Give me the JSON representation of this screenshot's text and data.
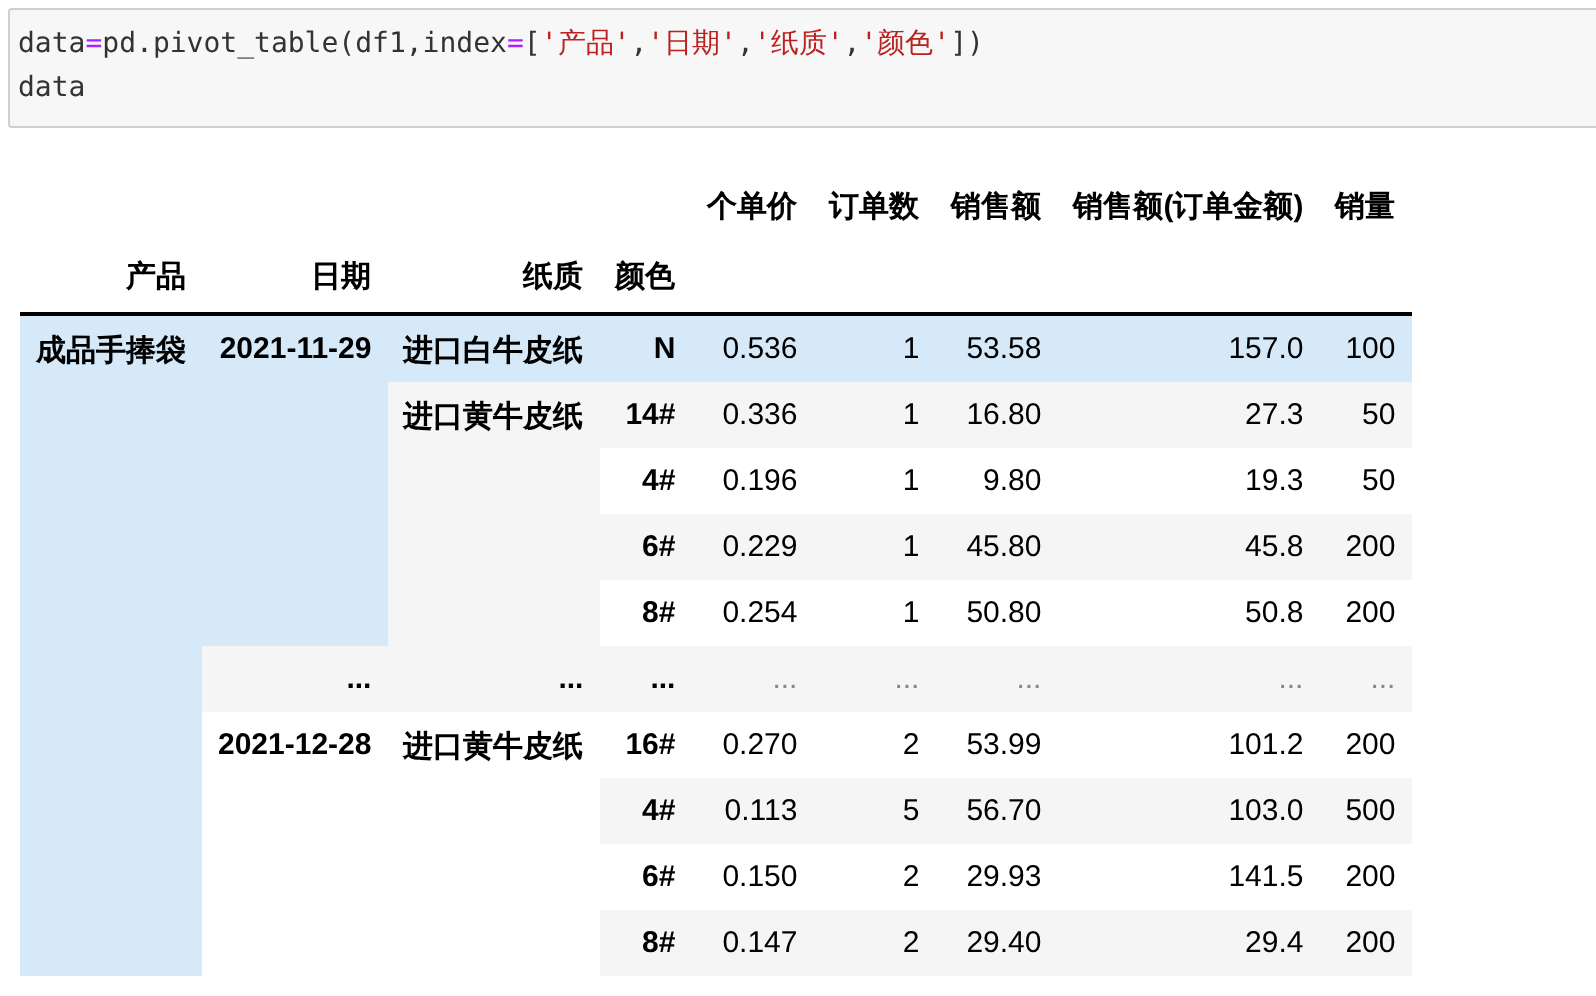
{
  "code_cell": {
    "lines": [
      [
        {
          "kind": "plain",
          "text": "data"
        },
        {
          "kind": "operator",
          "text": "="
        },
        {
          "kind": "plain",
          "text": "pd.pivot_table(df1,index"
        },
        {
          "kind": "operator",
          "text": "="
        },
        {
          "kind": "plain",
          "text": "["
        },
        {
          "kind": "string",
          "text": "'产品'"
        },
        {
          "kind": "plain",
          "text": ","
        },
        {
          "kind": "string",
          "text": "'日期'"
        },
        {
          "kind": "plain",
          "text": ","
        },
        {
          "kind": "string",
          "text": "'纸质'"
        },
        {
          "kind": "plain",
          "text": ","
        },
        {
          "kind": "string",
          "text": "'颜色'"
        },
        {
          "kind": "plain",
          "text": "])"
        }
      ],
      [
        {
          "kind": "plain",
          "text": "data"
        }
      ]
    ]
  },
  "table": {
    "columns": [
      "个单价",
      "订单数",
      "销售额",
      "销售额(订单金额)",
      "销量"
    ],
    "index_names": [
      "产品",
      "日期",
      "纸质",
      "颜色"
    ],
    "products": [
      {
        "label": "成品手捧袋",
        "dates": [
          {
            "label": "2021-11-29",
            "papers": [
              {
                "label": "进口白牛皮纸",
                "colors": [
                  {
                    "label": "N",
                    "values": [
                      "0.536",
                      "1",
                      "53.58",
                      "157.0",
                      "100"
                    ],
                    "hovered": true
                  }
                ]
              },
              {
                "label": "进口黄牛皮纸",
                "colors": [
                  {
                    "label": "14#",
                    "values": [
                      "0.336",
                      "1",
                      "16.80",
                      "27.3",
                      "50"
                    ],
                    "hovered": false
                  },
                  {
                    "label": "4#",
                    "values": [
                      "0.196",
                      "1",
                      "9.80",
                      "19.3",
                      "50"
                    ],
                    "hovered": false
                  },
                  {
                    "label": "6#",
                    "values": [
                      "0.229",
                      "1",
                      "45.80",
                      "45.8",
                      "200"
                    ],
                    "hovered": false
                  },
                  {
                    "label": "8#",
                    "values": [
                      "0.254",
                      "1",
                      "50.80",
                      "50.8",
                      "200"
                    ],
                    "hovered": false
                  }
                ]
              }
            ]
          },
          {
            "label": "...",
            "papers": [
              {
                "label": "...",
                "colors": [
                  {
                    "label": "...",
                    "values": [
                      "...",
                      "...",
                      "...",
                      "...",
                      "..."
                    ],
                    "hovered": false
                  }
                ]
              }
            ]
          },
          {
            "label": "2021-12-28",
            "papers": [
              {
                "label": "进口黄牛皮纸",
                "colors": [
                  {
                    "label": "16#",
                    "values": [
                      "0.270",
                      "2",
                      "53.99",
                      "101.2",
                      "200"
                    ],
                    "hovered": false
                  },
                  {
                    "label": "4#",
                    "values": [
                      "0.113",
                      "5",
                      "56.70",
                      "103.0",
                      "500"
                    ],
                    "hovered": false
                  },
                  {
                    "label": "6#",
                    "values": [
                      "0.150",
                      "2",
                      "29.93",
                      "141.5",
                      "200"
                    ],
                    "hovered": false
                  },
                  {
                    "label": "8#",
                    "values": [
                      "0.147",
                      "2",
                      "29.40",
                      "29.4",
                      "200"
                    ],
                    "hovered": false
                  }
                ]
              }
            ]
          }
        ]
      }
    ]
  }
}
